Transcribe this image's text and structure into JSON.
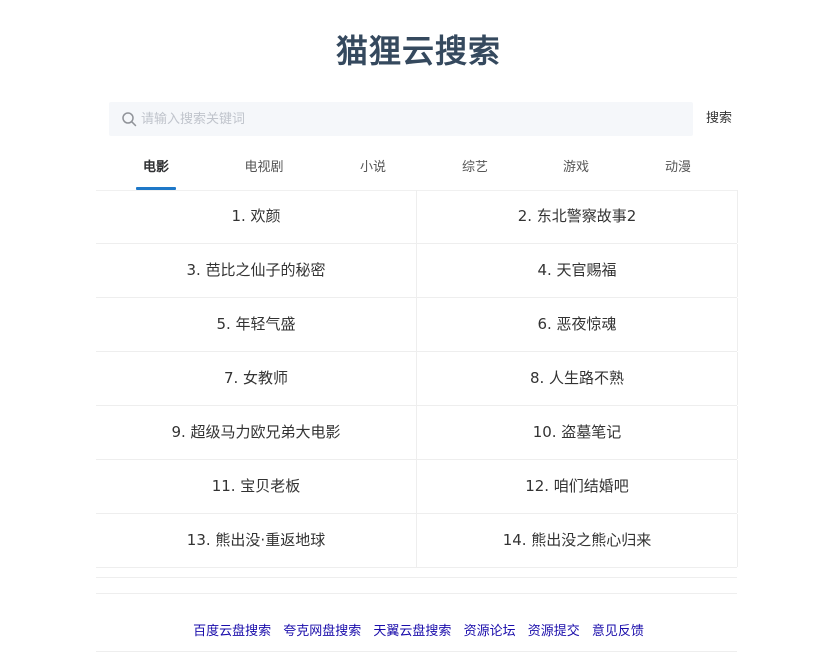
{
  "header": {
    "title": "猫狸云搜索"
  },
  "search": {
    "placeholder": "请输入搜索关键词",
    "value": "",
    "button_label": "搜索",
    "icon": "search-icon"
  },
  "tabs": [
    {
      "label": "电影",
      "active": true
    },
    {
      "label": "电视剧",
      "active": false
    },
    {
      "label": "小说",
      "active": false
    },
    {
      "label": "综艺",
      "active": false
    },
    {
      "label": "游戏",
      "active": false
    },
    {
      "label": "动漫",
      "active": false
    }
  ],
  "rankings": [
    "1. 欢颜",
    "2. 东北警察故事2",
    "3. 芭比之仙子的秘密",
    "4. 天官赐福",
    "5. 年轻气盛",
    "6. 恶夜惊魂",
    "7. 女教师",
    "8. 人生路不熟",
    "9. 超级马力欧兄弟大电影",
    "10. 盗墓笔记",
    "11. 宝贝老板",
    "12. 咱们结婚吧",
    "13. 熊出没·重返地球",
    "14. 熊出没之熊心归来"
  ],
  "footer": {
    "links": [
      "百度云盘搜索",
      "夸克网盘搜索",
      "天翼云盘搜索",
      "资源论坛",
      "资源提交",
      "意见反馈"
    ]
  },
  "colors": {
    "title": "#35495e",
    "accent": "#1e78c8",
    "link": "#1a0dab",
    "search_bg": "#f5f7fa"
  }
}
